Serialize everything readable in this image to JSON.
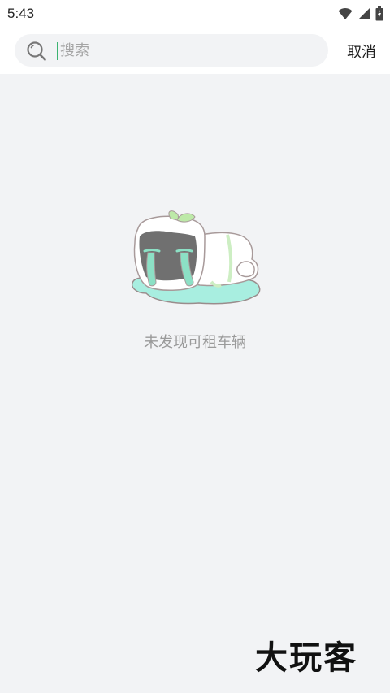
{
  "status_bar": {
    "time": "5:43",
    "icons": [
      "wifi-icon",
      "signal-icon",
      "battery-icon"
    ]
  },
  "search": {
    "placeholder": "搜索",
    "value": "",
    "cancel_label": "取消"
  },
  "empty_state": {
    "message": "未发现可租车辆",
    "illustration": "crying-tofu-character"
  },
  "watermark": {
    "text": "大玩客"
  },
  "colors": {
    "background": "#f2f3f5",
    "header_background": "#ffffff",
    "accent": "#3cb371",
    "empty_text": "#9a9a9a",
    "tear": "#7fd8c5"
  }
}
